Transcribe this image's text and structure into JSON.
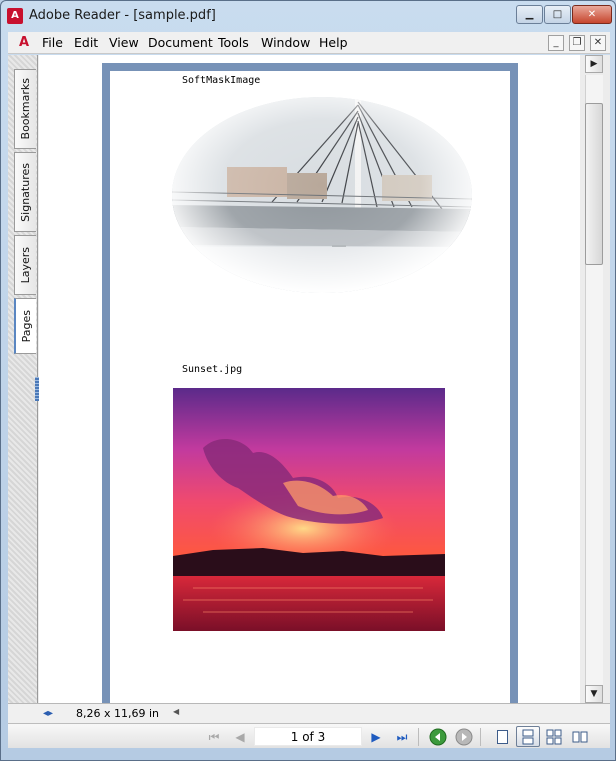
{
  "window": {
    "title": "Adobe Reader - [sample.pdf]",
    "app_icon_glyph": "A",
    "min_glyph": "▁",
    "max_glyph": "□",
    "close_glyph": "✕"
  },
  "menubar": {
    "items": [
      "File",
      "Edit",
      "View",
      "Document",
      "Tools",
      "Window",
      "Help"
    ],
    "pdf_glyph": "A",
    "mdi_min": "_",
    "mdi_restore": "❐",
    "mdi_close": "✕"
  },
  "side_tabs": [
    "Bookmarks",
    "Signatures",
    "Layers",
    "Pages"
  ],
  "document": {
    "caption1": "SoftMaskImage",
    "caption2": "Sunset.jpg"
  },
  "scrollbar": {
    "up_arrow": "▲",
    "down_arrow": "▼",
    "panel_arrow": "▶"
  },
  "status": {
    "page_size": "8,26 x 11,69 in",
    "split_icon": "◂▸",
    "hscroll_arrow": "◀"
  },
  "toolbar": {
    "first_glyph": "⏮",
    "prev_glyph": "◀",
    "page_indicator": "1 of 3",
    "next_glyph": "▶",
    "last_glyph": "⏭",
    "back_glyph": "◀",
    "forward_glyph": "▶"
  },
  "colors": {
    "page_border": "#7792b7",
    "title_gradient_top": "#c9dcef",
    "close_button": "#c6452d",
    "nav_blue": "#1f5bbf"
  },
  "icons": {
    "app": "adobe-reader-icon",
    "first_page": "first-page-icon",
    "previous_page": "previous-page-icon",
    "next_page": "next-page-icon",
    "last_page": "last-page-icon",
    "go_back": "go-back-icon",
    "go_forward": "go-forward-icon",
    "single_page": "single-page-icon",
    "single_continuous": "single-continuous-icon",
    "two_up": "two-up-icon",
    "two_up_continuous": "two-up-continuous-icon"
  }
}
